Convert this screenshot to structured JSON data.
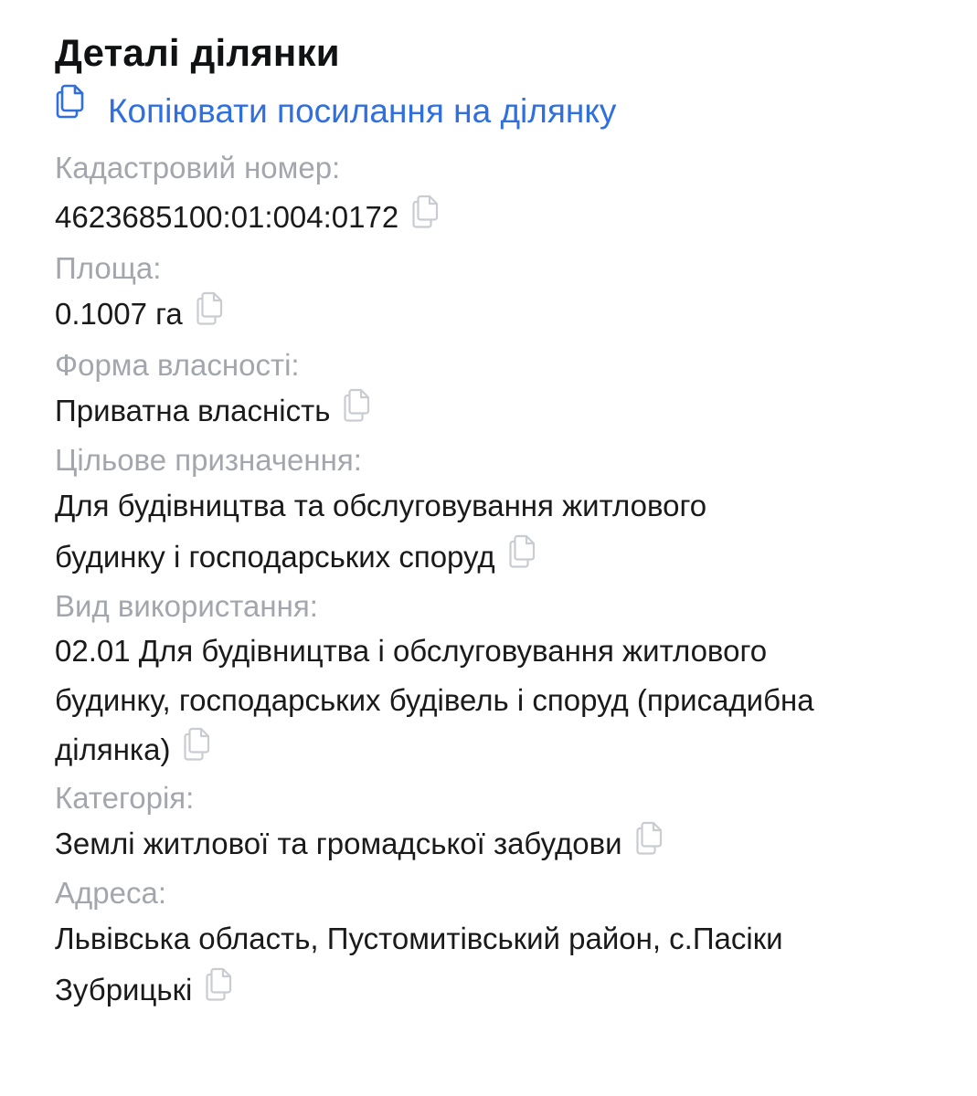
{
  "panel": {
    "title": "Деталі ділянки",
    "copy_link_label": "Копіювати посилання на ділянку"
  },
  "fields": {
    "cadastral": {
      "label": "Кадастровий номер:",
      "value": "4623685100:01:004:0172"
    },
    "area": {
      "label": "Площа:",
      "value": "0.1007 га"
    },
    "ownership": {
      "label": "Форма власності:",
      "value": "Приватна власність"
    },
    "purpose": {
      "label": "Цільове призначення:",
      "line1": "Для будівництва та обслуговування житлового",
      "line2": "будинку і господарських споруд"
    },
    "usage": {
      "label": "Вид використання:",
      "line1": "02.01 Для будівництва і обслуговування житлового",
      "line2": "будинку, господарських будівель і споруд (присадибна",
      "line3": "ділянка)"
    },
    "category": {
      "label": "Категорія:",
      "value": "Землі житлової та громадської забудови"
    },
    "address": {
      "label": "Адреса:",
      "line1": "Львівська область, Пустомитівський район, с.Пасіки",
      "line2": "Зубрицькі"
    }
  },
  "icons": {
    "link_copy": "copy-link-icon",
    "value_copy": "copy-icon"
  },
  "colors": {
    "link": "#2f6fe0",
    "label": "#a3a7ad",
    "value": "#1a1a1a",
    "title": "#101214",
    "copy_icon": "#c9ccd1"
  }
}
